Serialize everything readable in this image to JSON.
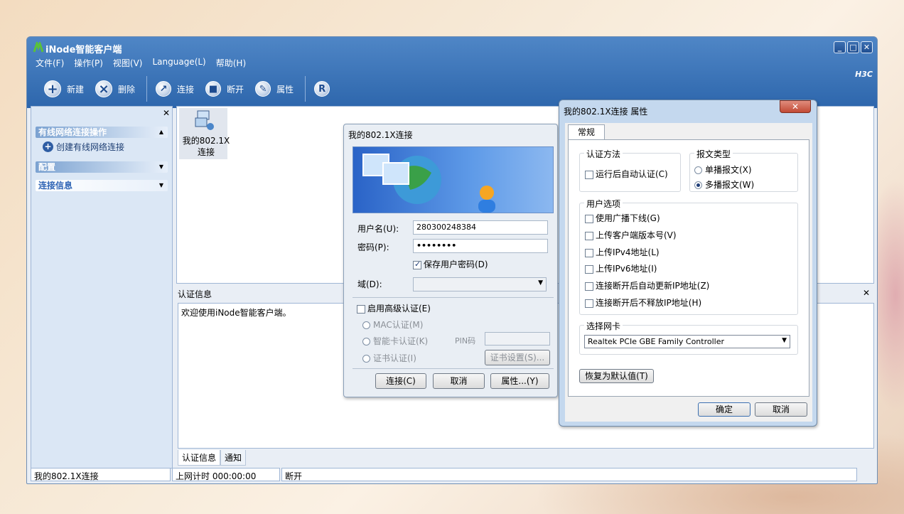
{
  "app": {
    "title": "iNode智能客户端",
    "brand": "H3C",
    "menu": [
      "文件(F)",
      "操作(P)",
      "视图(V)",
      "Language(L)",
      "帮助(H)"
    ],
    "toolbar": {
      "new": "新建",
      "delete": "删除",
      "connect": "连接",
      "disconnect": "断开",
      "properties": "属性"
    },
    "leftpanel": {
      "section1": "有线网络连接操作",
      "create_link": "创建有线网络连接",
      "section2": "配置",
      "section3": "连接信息"
    },
    "connection": {
      "label_line1": "我的802.1X",
      "label_line2": "连接"
    },
    "authinfo": {
      "title": "认证信息",
      "message": "欢迎使用iNode智能客户端。",
      "tab_auth": "认证信息",
      "tab_notice": "通知"
    },
    "status": {
      "conn_name": "我的802.1X连接",
      "online_time": "上网计时 000:00:00",
      "state": "断开"
    }
  },
  "login_dialog": {
    "title": "我的802.1X连接",
    "username_label": "用户名(U):",
    "username_value": "280300248384",
    "password_label": "密码(P):",
    "password_value": "••••••••",
    "save_password": "保存用户密码(D)",
    "domain_label": "域(D):",
    "domain_value": "",
    "advanced_auth": "启用高级认证(E)",
    "mac_auth": "MAC认证(M)",
    "smartcard_auth": "智能卡认证(K)",
    "pin_label": "PIN码",
    "cert_auth": "证书认证(I)",
    "cert_settings": "证书设置(S)...",
    "btn_connect": "连接(C)",
    "btn_cancel": "取消",
    "btn_properties": "属性...(Y)"
  },
  "props_dialog": {
    "title": "我的802.1X连接  属性",
    "tab": "常规",
    "auth_method_title": "认证方法",
    "auto_auth": "运行后自动认证(C)",
    "packet_type_title": "报文类型",
    "unicast": "单播报文(X)",
    "multicast": "多播报文(W)",
    "user_options_title": "用户选项",
    "opt1": "使用广播下线(G)",
    "opt2": "上传客户端版本号(V)",
    "opt3": "上传IPv4地址(L)",
    "opt4": "上传IPv6地址(I)",
    "opt5": "连接断开后自动更新IP地址(Z)",
    "opt6": "连接断开后不释放IP地址(H)",
    "nic_title": "选择网卡",
    "nic_value": "Realtek PCIe GBE Family Controller",
    "restore_default": "恢复为默认值(T)",
    "btn_ok": "确定",
    "btn_cancel": "取消"
  }
}
